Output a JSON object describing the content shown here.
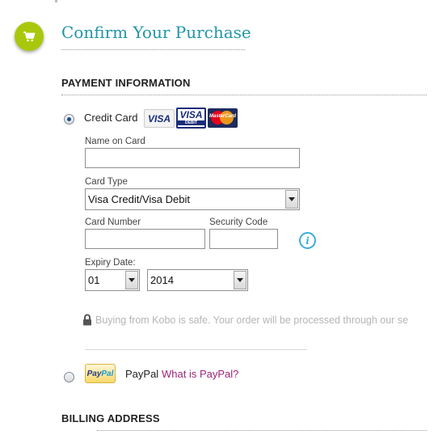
{
  "header": {
    "title": "Confirm Your Purchase"
  },
  "payment": {
    "heading": "PAYMENT INFORMATION",
    "credit_card": {
      "label": "Credit Card",
      "selected": true,
      "logos": {
        "visa_text": "VISA",
        "visa_debit_text": "VISA",
        "visa_debit_sub": "DEBIT",
        "mastercard_text": "MasterCard"
      },
      "name_label": "Name on Card",
      "name_value": "",
      "card_type_label": "Card Type",
      "card_type_value": "Visa Credit/Visa Debit",
      "card_number_label": "Card Number",
      "card_number_value": "",
      "security_code_label": "Security Code",
      "security_code_value": "",
      "info_icon_glyph": "i",
      "expiry_label": "Expiry Date:",
      "expiry_month": "01",
      "expiry_year": "2014",
      "secure_note": "Buying from Kobo is safe. Your order will be processed through our se"
    },
    "paypal": {
      "badge_part1": "Pay",
      "badge_part2": "Pal",
      "label": "PayPal",
      "link": "What is PayPal?",
      "selected": false
    }
  },
  "billing": {
    "heading": "BILLING ADDRESS"
  },
  "colors": {
    "accent": "#2196a9",
    "cart_badge": "#a9c80b",
    "link": "#a0247c",
    "info": "#3aaedb"
  },
  "icons": {
    "cart": "cart-icon",
    "lock": "lock-icon",
    "info": "info-icon",
    "dropdown": "chevron-down-icon"
  }
}
